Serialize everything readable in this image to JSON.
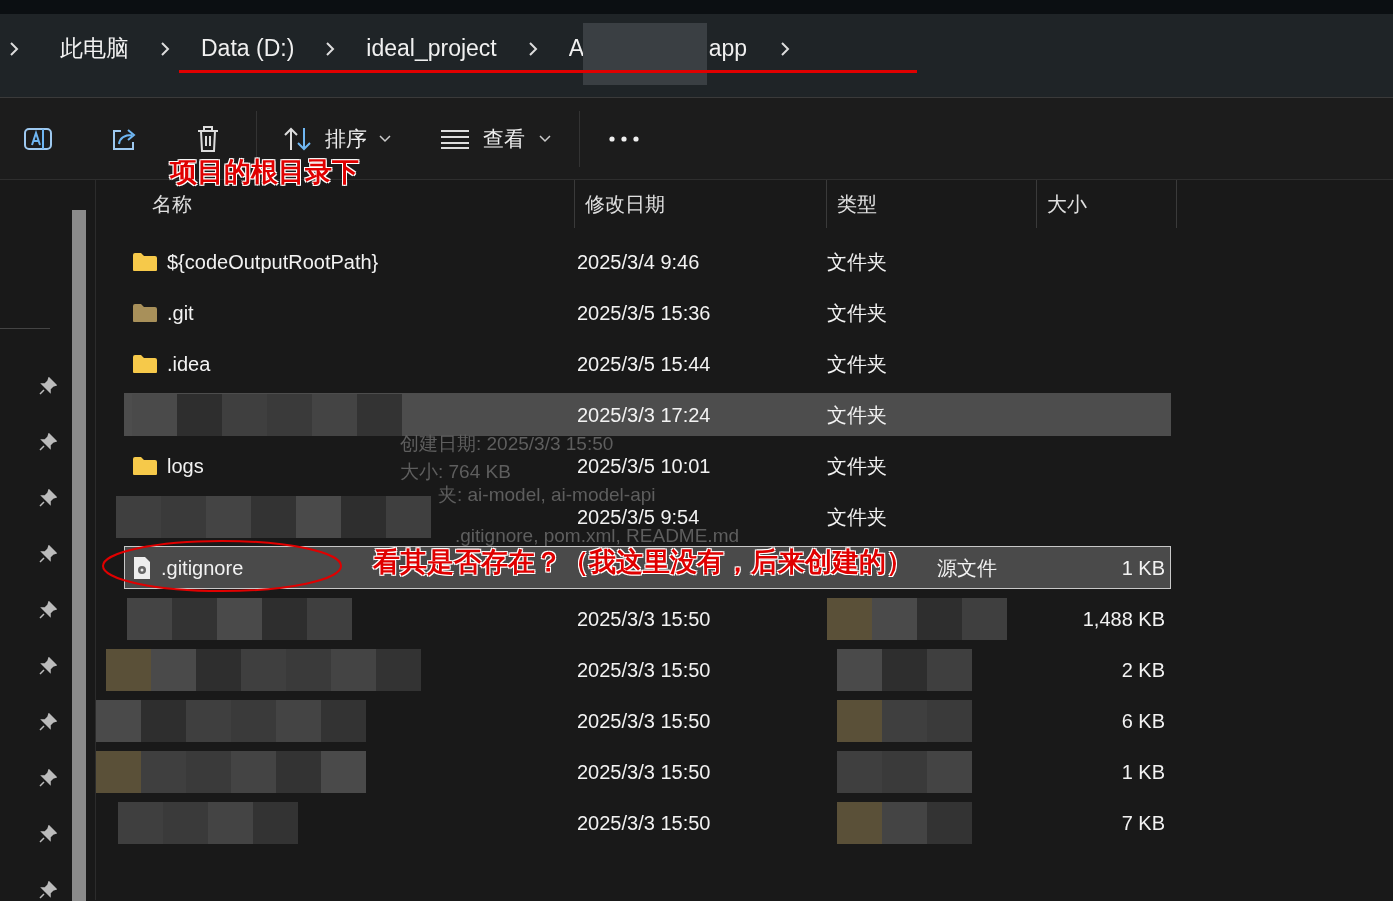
{
  "breadcrumb": [
    {
      "label": "此电脑",
      "redacted": false
    },
    {
      "label": "Data (D:)",
      "redacted": false
    },
    {
      "label": "ideal_project",
      "redacted": false
    },
    {
      "label": "A",
      "redacted": true
    },
    {
      "label": "app",
      "redacted": false
    }
  ],
  "toolbar": {
    "sort": "排序",
    "view": "查看"
  },
  "columns": [
    "名称",
    "修改日期",
    "类型",
    "大小"
  ],
  "rows": [
    {
      "kind": "folder",
      "name": "${codeOutputRootPath}",
      "date": "2025/3/4 9:46",
      "type": "文件夹",
      "selected": false
    },
    {
      "kind": "folder-dim",
      "name": ".git",
      "date": "2025/3/5 15:36",
      "type": "文件夹",
      "selected": false
    },
    {
      "kind": "folder",
      "name": ".idea",
      "date": "2025/3/5 15:44",
      "type": "文件夹",
      "selected": false
    },
    {
      "kind": "redacted",
      "date": "2025/3/3 17:24",
      "type": "文件夹",
      "selected": true
    },
    {
      "kind": "folder",
      "name": "logs",
      "date": "2025/3/5 10:01",
      "type": "文件夹",
      "selected": false
    },
    {
      "kind": "redacted",
      "date": "2025/3/5 9:54",
      "type": "文件夹",
      "selected": false
    },
    {
      "kind": "file",
      "name": ".gitignore",
      "type": "源文件",
      "size": "1 KB",
      "selected": true,
      "focused": true
    },
    {
      "kind": "redacted",
      "date": "2025/3/3 15:50",
      "size": "1,488 KB",
      "selected": false
    },
    {
      "kind": "redacted",
      "date": "2025/3/3 15:50",
      "size": "2 KB",
      "selected": false
    },
    {
      "kind": "redacted",
      "date": "2025/3/3 15:50",
      "size": "6 KB",
      "selected": false
    },
    {
      "kind": "redacted",
      "date": "2025/3/3 15:50",
      "size": "1 KB",
      "selected": false
    },
    {
      "kind": "redacted",
      "date": "2025/3/3 15:50",
      "size": "7 KB",
      "selected": false
    }
  ],
  "tooltip": {
    "lines": [
      "创建日期: 2025/3/3 15:50",
      "大小: 764 KB",
      "夹: ai-model, ai-model-api",
      ".gitignore, pom.xml, README.md"
    ]
  },
  "annotations": [
    {
      "kind": "caption",
      "text": "项目的根目录下"
    },
    {
      "kind": "caption",
      "text": "看其是否存在？（我这里没有，后来创建的）"
    }
  ]
}
